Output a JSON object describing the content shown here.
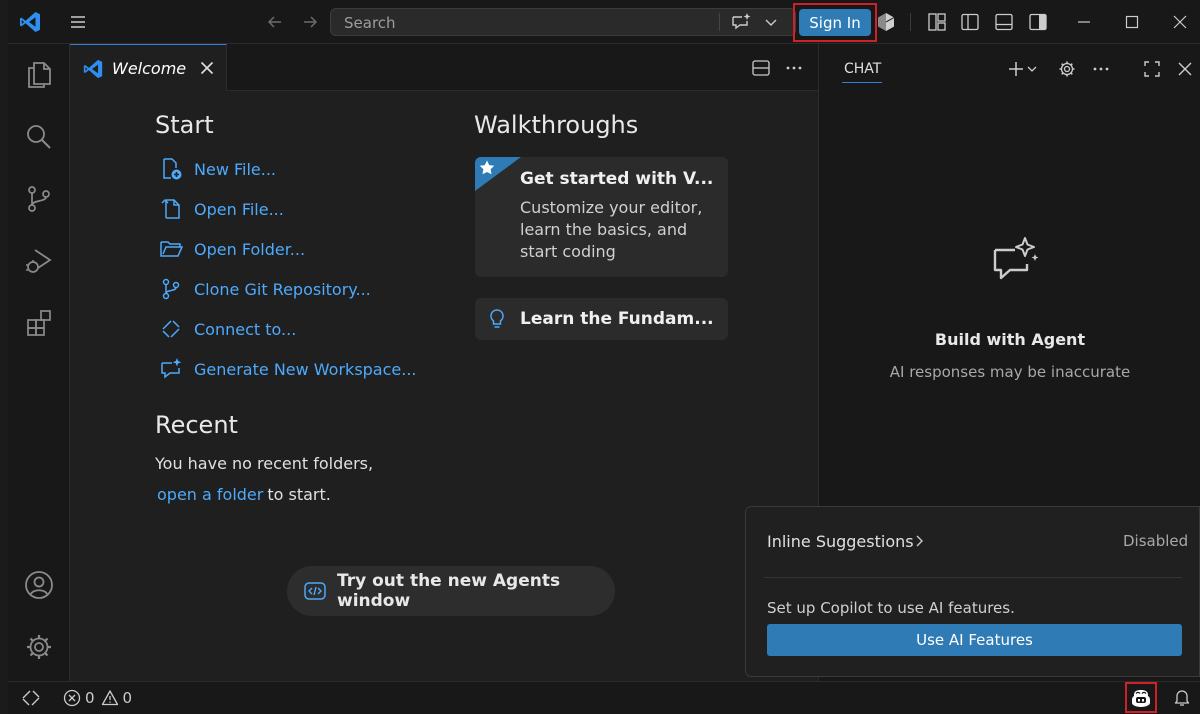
{
  "titlebar": {
    "search_placeholder": "Search",
    "sign_in_label": "Sign In"
  },
  "tab": {
    "label": "Welcome"
  },
  "welcome": {
    "start_heading": "Start",
    "start_items": [
      {
        "label": "New File...",
        "icon": "new-file-icon"
      },
      {
        "label": "Open File...",
        "icon": "open-file-icon"
      },
      {
        "label": "Open Folder...",
        "icon": "folder-icon"
      },
      {
        "label": "Clone Git Repository...",
        "icon": "git-branch-icon"
      },
      {
        "label": "Connect to...",
        "icon": "remote-icon"
      },
      {
        "label": "Generate New Workspace...",
        "icon": "chat-sparkle-icon"
      }
    ],
    "recent_heading": "Recent",
    "recent_empty": "You have no recent folders,",
    "recent_link": "open a folder",
    "recent_suffix": "to start.",
    "walkthroughs_heading": "Walkthroughs",
    "walk1_title": "Get started with V...",
    "walk1_desc": "Customize your editor, learn the basics, and start coding",
    "walk2_title": "Learn the Fundam...",
    "agents_button": "Try out the new Agents window"
  },
  "chat": {
    "title": "CHAT",
    "agent_title": "Build with Agent",
    "agent_subtitle": "AI responses may be inaccurate"
  },
  "popup": {
    "inline_label": "Inline Suggestions",
    "inline_status": "Disabled",
    "setup_text": "Set up Copilot to use AI features.",
    "use_button": "Use AI Features"
  },
  "statusbar": {
    "errors": "0",
    "warnings": "0"
  },
  "colors": {
    "accent": "#2f7bb6",
    "link": "#4daafc",
    "highlight_box": "#d0202a"
  }
}
